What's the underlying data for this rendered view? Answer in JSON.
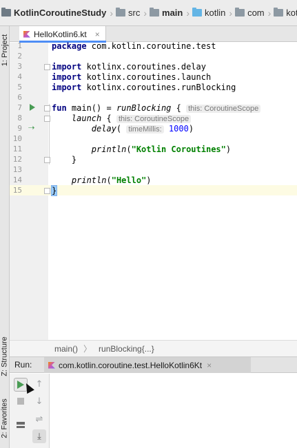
{
  "navbar": {
    "crumbs": [
      "KotlinCoroutineStudy",
      "src",
      "main",
      "kotlin",
      "com",
      "kot"
    ]
  },
  "left_tools": {
    "project": "1: Project",
    "structure": "Z: Structure",
    "favorites": "2: Favorites"
  },
  "editor_tab": {
    "label": "HelloKotlin6.kt",
    "close": "×"
  },
  "code": {
    "line_numbers": [
      "1",
      "2",
      "3",
      "4",
      "5",
      "6",
      "7",
      "8",
      "9",
      "10",
      "11",
      "12",
      "13",
      "14",
      "15"
    ],
    "l1": {
      "kw": "package",
      "rest": " com.kotlin.coroutine.test"
    },
    "l3": {
      "kw": "import",
      "rest": " kotlinx.coroutines.delay"
    },
    "l4": {
      "kw": "import",
      "rest": " kotlinx.coroutines.launch"
    },
    "l5": {
      "kw": "import",
      "rest": " kotlinx.coroutines.runBlocking"
    },
    "l7": {
      "kw": "fun",
      "rest": " main() = ",
      "call": "runBlocking",
      "brace": " {",
      "hint": "this: CoroutineScope"
    },
    "l8": {
      "call": "launch",
      "brace": " {",
      "hint": "this: CoroutineScope"
    },
    "l9": {
      "call": "delay",
      "paren": "(",
      "hint": "timeMillis:",
      "num": "1000",
      "close": ")"
    },
    "l11": {
      "call": "println",
      "open": "(",
      "str": "\"Kotlin Coroutines\"",
      "close": ")"
    },
    "l12": {
      "brace": "}"
    },
    "l14": {
      "call": "println",
      "open": "(",
      "str": "\"Hello\"",
      "close": ")"
    },
    "l15": {
      "brace": "}"
    }
  },
  "editor_breadcrumbs": {
    "first": "main()",
    "sep": "〉",
    "second": "runBlocking{...}"
  },
  "run_panel": {
    "label": "Run:",
    "tab_label": "com.kotlin.coroutine.test.HelloKotlin6Kt",
    "tab_close": "×"
  },
  "colors": {
    "keyword": "#000080",
    "string": "#008000",
    "number": "#0000ff",
    "run_green": "#499c54",
    "tab_accent": "#4e8df5"
  }
}
